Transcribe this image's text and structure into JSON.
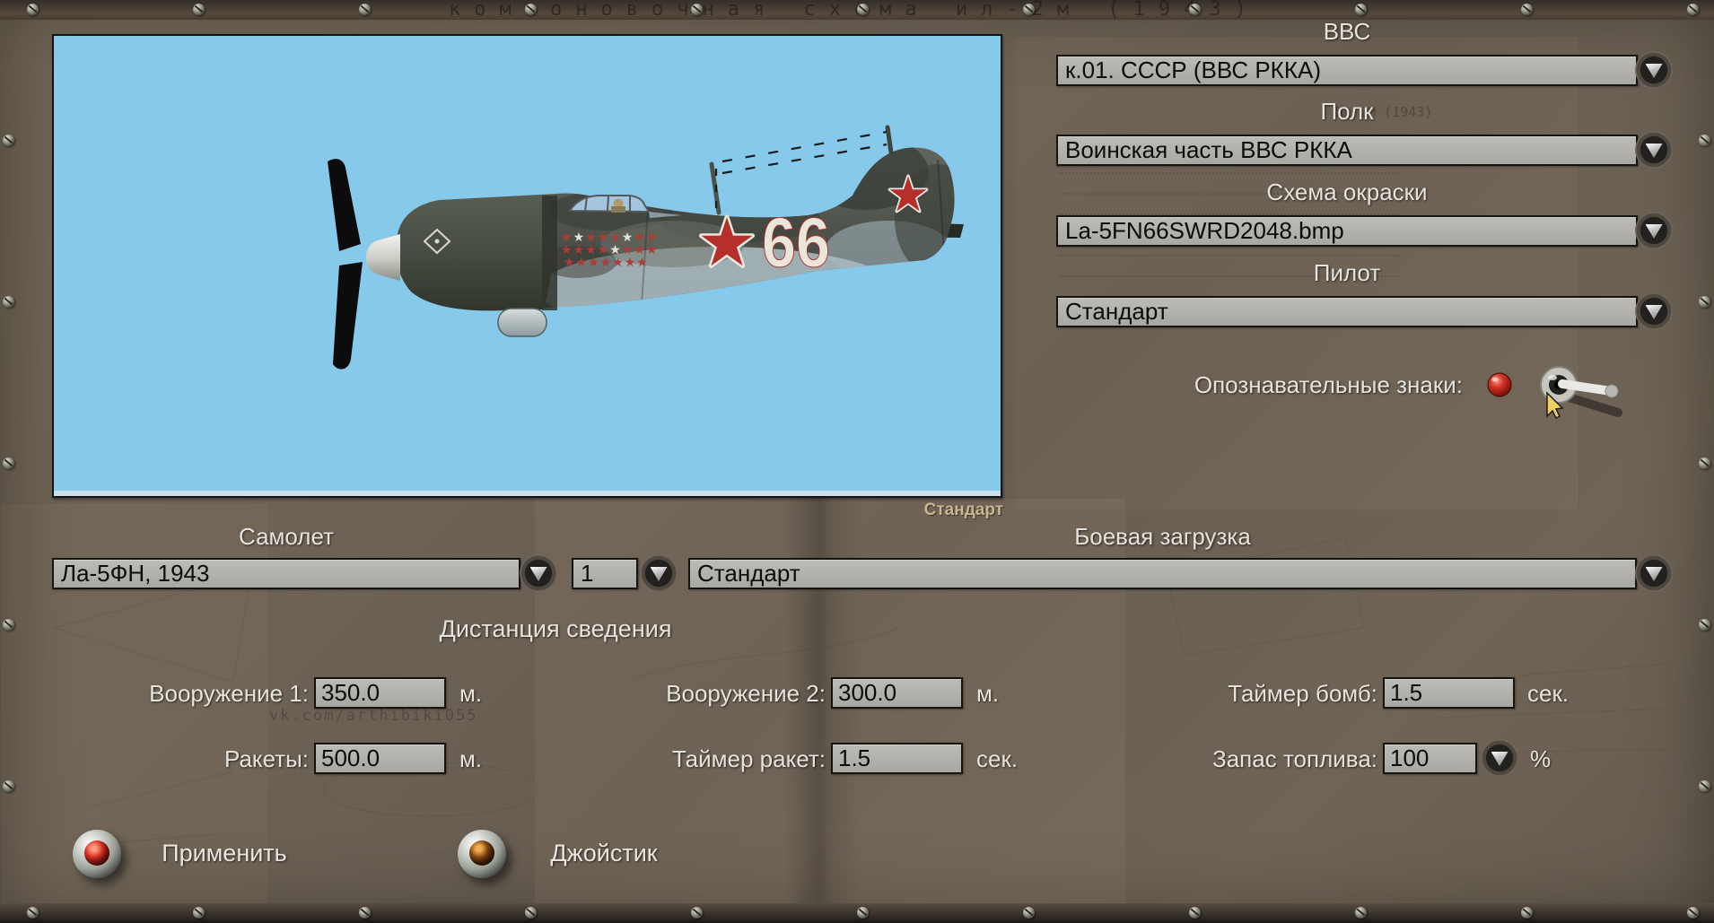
{
  "background": {
    "top_title": "компоновочная схема ил-2м (1943)",
    "faded_note": "Ил-2М (1943)",
    "watermark": "vk.com/arthibiki055"
  },
  "preview": {
    "caption": "Стандарт",
    "sky_color": "#87c9ea",
    "aircraft_number": "66"
  },
  "selectors": {
    "vvs": {
      "label": "ВВС",
      "value": "к.01. СССР (ВВС РККА)"
    },
    "polk": {
      "label": "Полк",
      "value": "Воинская часть ВВС РККА"
    },
    "skin": {
      "label": "Схема окраски",
      "value": "La-5FN66SWRD2048.bmp"
    },
    "pilot": {
      "label": "Пилот",
      "value": "Стандарт"
    },
    "markings_label": "Опознавательные знаки:"
  },
  "aircraft": {
    "label": "Самолет",
    "value": "Ла-5ФН, 1943",
    "count": "1",
    "loadout_label": "Боевая загрузка",
    "loadout_value": "Стандарт"
  },
  "convergence": {
    "title": "Дистанция сведения",
    "weapon1": {
      "label": "Вооружение 1:",
      "value": "350.0",
      "unit": "м."
    },
    "weapon2": {
      "label": "Вооружение 2:",
      "value": "300.0",
      "unit": "м."
    },
    "bomb_timer": {
      "label": "Таймер бомб:",
      "value": "1.5",
      "unit": "сек."
    },
    "rockets": {
      "label": "Ракеты:",
      "value": "500.0",
      "unit": "м."
    },
    "rocket_timer": {
      "label": "Таймер ракет:",
      "value": "1.5",
      "unit": "сек."
    },
    "fuel": {
      "label": "Запас топлива:",
      "value": "100",
      "unit": "%"
    }
  },
  "actions": {
    "apply": "Применить",
    "joystick": "Джойстик"
  },
  "colors": {
    "accent_red": "#c22318",
    "panel_brown": "#6e6357",
    "field_grey": "#b4b2ad",
    "caption_tan": "#c9b58e",
    "sky_blue": "#87c9ea"
  }
}
